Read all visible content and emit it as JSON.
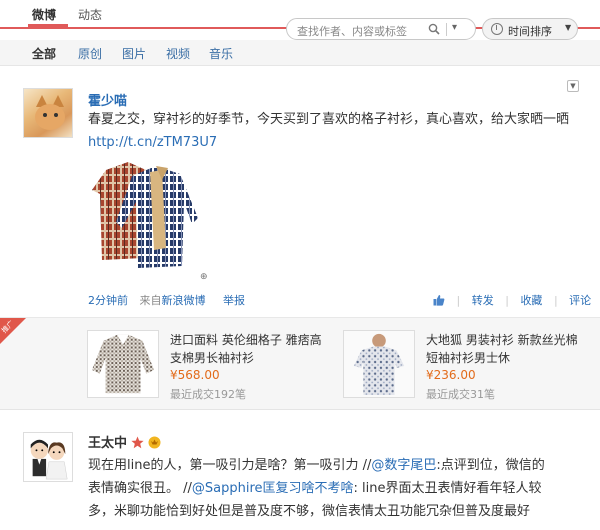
{
  "tabs": {
    "active": "微博",
    "other": "动态"
  },
  "search": {
    "placeholder": "查找作者、内容或标签"
  },
  "sort": {
    "label": "时间排序"
  },
  "filters": [
    "全部",
    "原创",
    "图片",
    "视频",
    "音乐"
  ],
  "post1": {
    "author": "霍少喵",
    "text": "春夏之交，穿衬衫的好季节，今天买到了喜欢的格子衬衫，真心喜欢，给大家晒一晒",
    "link": "http://t.cn/zTM73U7",
    "time": "2分钟前",
    "source_prefix": "来自",
    "source": "新浪微博",
    "report": "举报",
    "actions": {
      "forward": "转发",
      "favorite": "收藏",
      "comment": "评论"
    }
  },
  "ad": {
    "ribbon": "推广",
    "products": [
      {
        "title": "进口面料 英伦细格子 雅痞高支棉男长袖衬衫",
        "price": "¥568.00",
        "sales": "最近成交192笔"
      },
      {
        "title": "大地狐 男装衬衫 新款丝光棉短袖衬衫男士休",
        "price": "¥236.00",
        "sales": "最近成交31笔"
      }
    ]
  },
  "post2": {
    "author": "王太中",
    "line1_a": "现在用line的人，第一吸引力是啥？第一吸引力 //",
    "mention1": "@数字尾巴",
    "line1_b": ":点评到位，微信的",
    "line2": "表情确实很丑。 //",
    "mention2": "@Sapphire匡复习啥不考啥",
    "line2_b": ": line界面太丑表情好看年轻人较",
    "line3": "多，米聊功能恰到好处但是普及度不够，微信表情太丑功能冗杂但普及度最好"
  },
  "colors": {
    "accent_red": "#e05a5a",
    "link_blue": "#2a6db5",
    "price_orange": "#e26b1a"
  }
}
